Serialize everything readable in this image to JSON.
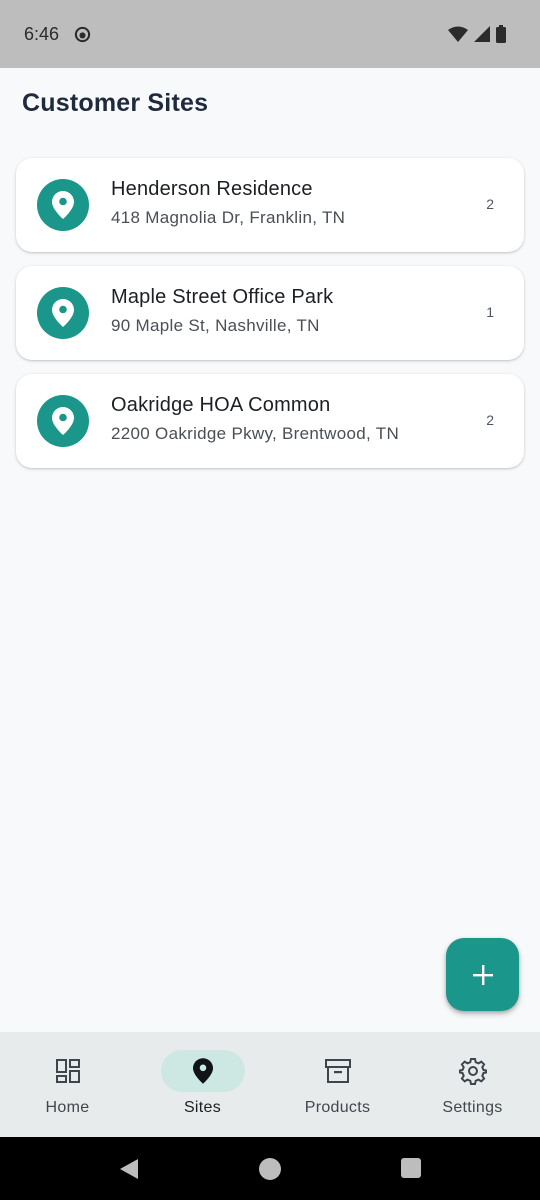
{
  "status_bar": {
    "time": "6:46"
  },
  "header": {
    "title": "Customer Sites"
  },
  "sites": [
    {
      "name": "Henderson Residence",
      "address": "418 Magnolia Dr, Franklin, TN",
      "count": "2"
    },
    {
      "name": "Maple Street Office Park",
      "address": "90 Maple St, Nashville, TN",
      "count": "1"
    },
    {
      "name": "Oakridge HOA Common",
      "address": "2200 Oakridge Pkwy, Brentwood, TN",
      "count": "2"
    }
  ],
  "fab": {
    "icon": "plus-icon"
  },
  "bottom_nav": {
    "items": [
      {
        "label": "Home",
        "icon": "dashboard-icon",
        "active": false
      },
      {
        "label": "Sites",
        "icon": "location-pin-icon",
        "active": true
      },
      {
        "label": "Products",
        "icon": "archive-box-icon",
        "active": false
      },
      {
        "label": "Settings",
        "icon": "gear-icon",
        "active": false
      }
    ]
  },
  "colors": {
    "accent": "#1a968a",
    "active_pill": "#cde8e3",
    "title": "#1f2a3c"
  }
}
